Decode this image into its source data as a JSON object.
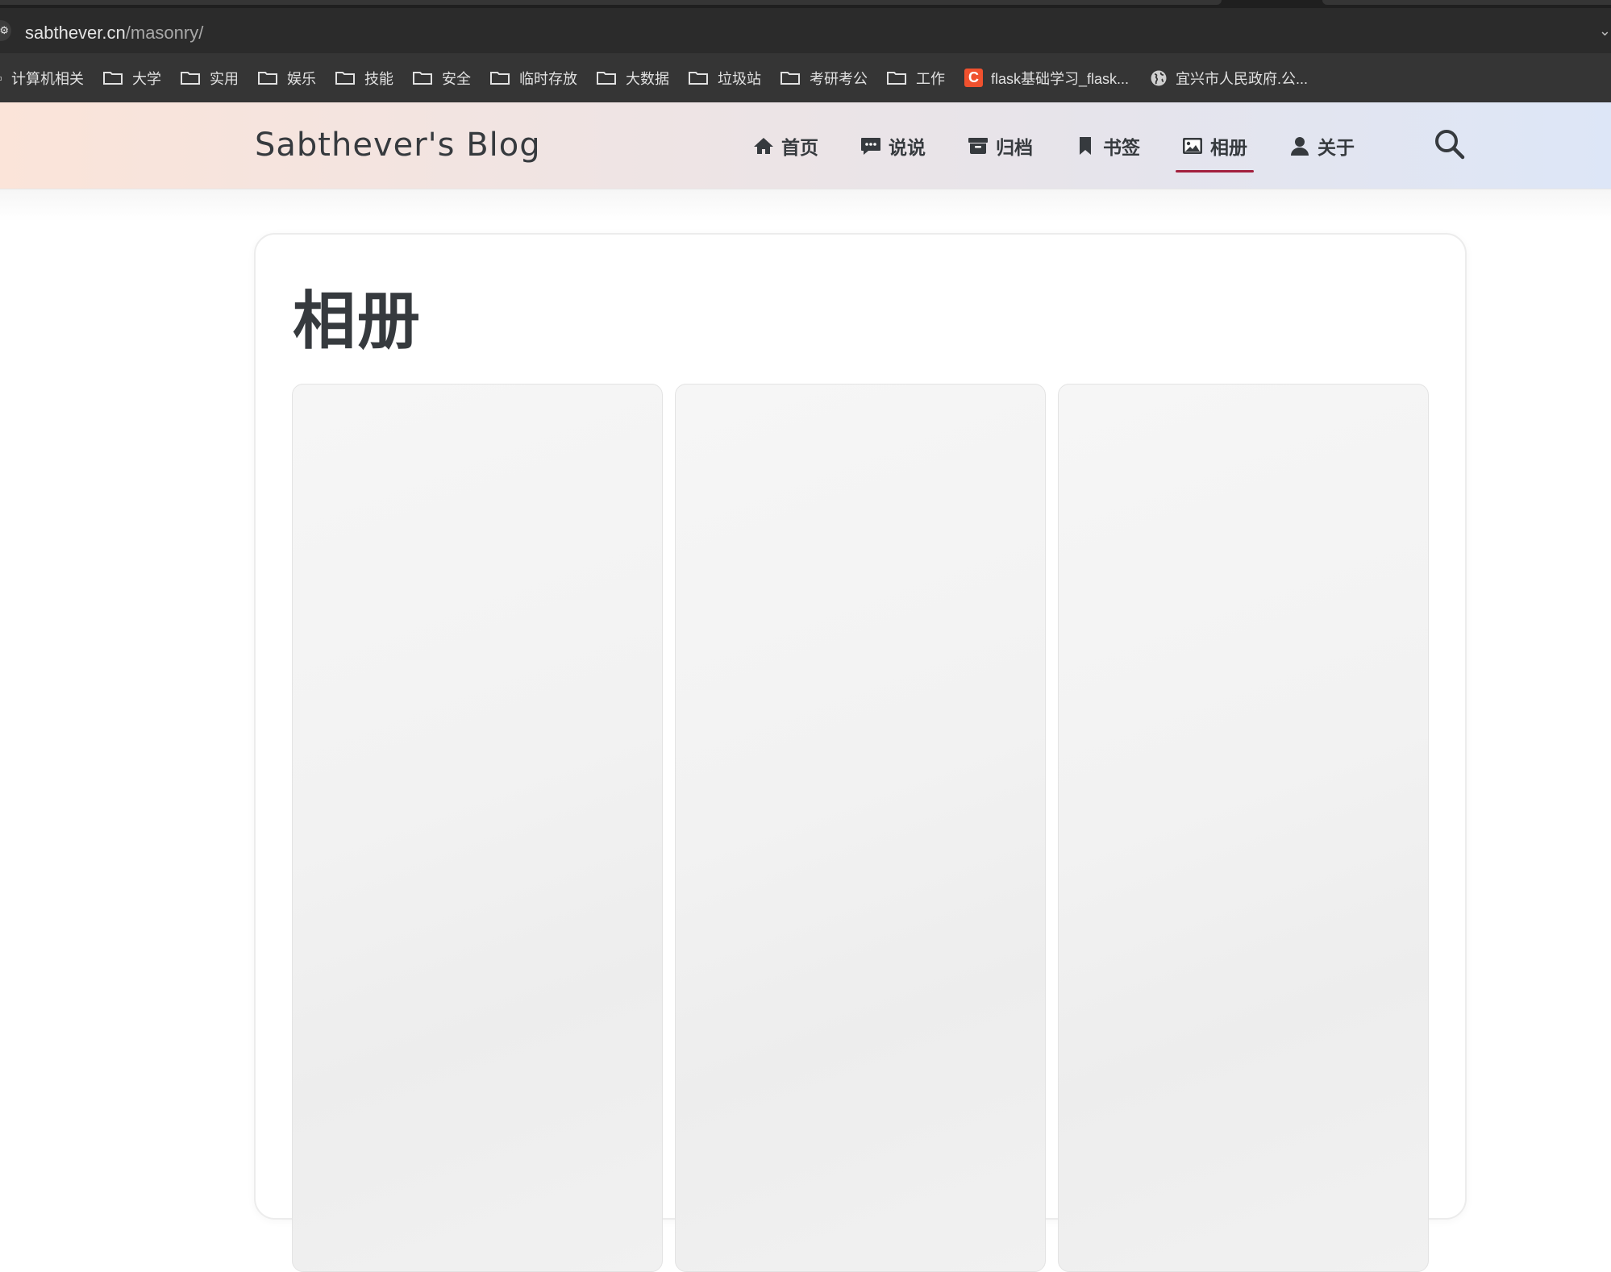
{
  "browser": {
    "url_host": "sabthever.cn",
    "url_path": "/masonry/",
    "bookmarks": [
      {
        "label": "计算机相关",
        "icon": "folder-icon"
      },
      {
        "label": "大学",
        "icon": "folder-icon"
      },
      {
        "label": "实用",
        "icon": "folder-icon"
      },
      {
        "label": "娱乐",
        "icon": "folder-icon"
      },
      {
        "label": "技能",
        "icon": "folder-icon"
      },
      {
        "label": "安全",
        "icon": "folder-icon"
      },
      {
        "label": "临时存放",
        "icon": "folder-icon"
      },
      {
        "label": "大数据",
        "icon": "folder-icon"
      },
      {
        "label": "垃圾站",
        "icon": "folder-icon"
      },
      {
        "label": "考研考公",
        "icon": "folder-icon"
      },
      {
        "label": "工作",
        "icon": "folder-icon"
      },
      {
        "label": "flask基础学习_flask...",
        "icon": "csdn-icon",
        "icon_text": "C"
      },
      {
        "label": "宜兴市人民政府.公...",
        "icon": "globe-icon"
      }
    ]
  },
  "site": {
    "title": "Sabthever's Blog",
    "nav": [
      {
        "label": "首页",
        "icon": "home-icon"
      },
      {
        "label": "说说",
        "icon": "comment-icon"
      },
      {
        "label": "归档",
        "icon": "archive-icon"
      },
      {
        "label": "书签",
        "icon": "bookmark-icon"
      },
      {
        "label": "相册",
        "icon": "image-icon",
        "active": true
      },
      {
        "label": "关于",
        "icon": "user-icon"
      }
    ],
    "accent_color": "#a3203d"
  },
  "page": {
    "title": "相册",
    "gallery": {
      "columns": 3
    }
  }
}
